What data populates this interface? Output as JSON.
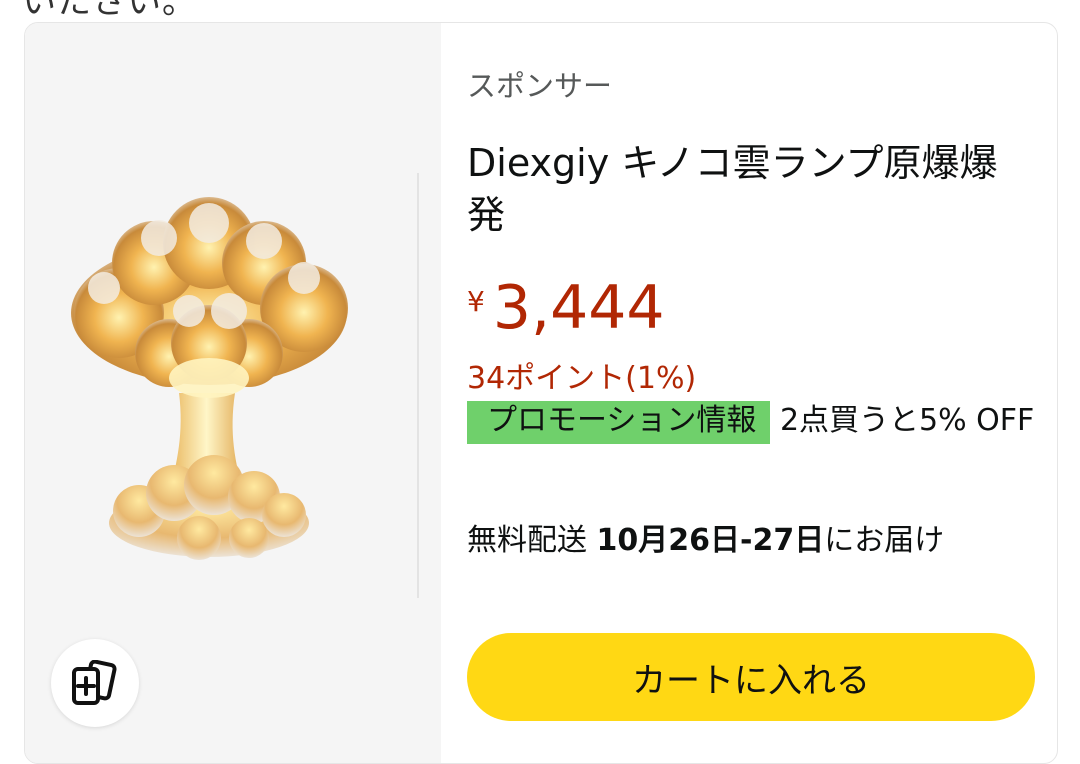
{
  "header": {
    "fragment_text": "いたさい。"
  },
  "product": {
    "sponsored_label": "スポンサー",
    "title": "Diexgiy キノコ雲ランプ原爆爆発",
    "price_symbol": "¥",
    "price_amount": "3,444",
    "points": "34ポイント(1%)",
    "promo_badge": "プロモーション情報",
    "promo_text": " 2点買うと5% OFF",
    "delivery_prefix": "無料配送 ",
    "delivery_date": "10月26日-27日",
    "delivery_suffix": "にお届け",
    "cart_button": "カートに入れる"
  },
  "colors": {
    "price": "#b12704",
    "promo_badge": "#6fd06b",
    "cart_button": "#ffd814"
  },
  "icons": {
    "compare": "compare-cards-icon",
    "product_image": "mushroom-cloud-lamp"
  }
}
